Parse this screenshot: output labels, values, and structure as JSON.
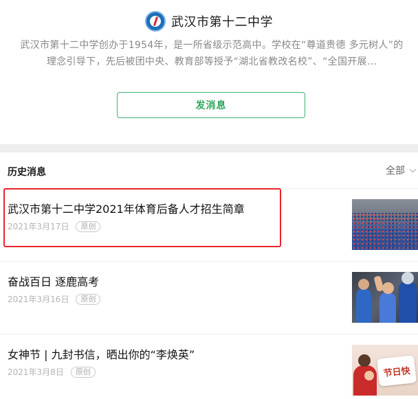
{
  "profile": {
    "name": "武汉市第十二中学",
    "intro": "武汉市第十二中学创办于1954年，是一所省级示范高中。学校在“尊道贵德 多元树人”的理念引导下，先后被团中央、教育部等授予“湖北省教改名校”、“全国开展...",
    "send_label": "发消息"
  },
  "history": {
    "title": "历史消息",
    "filter_label": "全部"
  },
  "articles": [
    {
      "title": "武汉市第十二中学2021年体育后备人才招生简章",
      "date": "2021年3月17日",
      "tag": "原创"
    },
    {
      "title": "奋战百日 逐鹿高考",
      "date": "2021年3月16日",
      "tag": "原创"
    },
    {
      "title": "女神节 | 九封书信，晒出你的“李焕英”",
      "date": "2021年3月8日",
      "tag": "原创",
      "thumb_text": "节日快"
    }
  ],
  "colors": {
    "accent_green": "#2aa55a",
    "highlight_red": "#e8232a"
  }
}
